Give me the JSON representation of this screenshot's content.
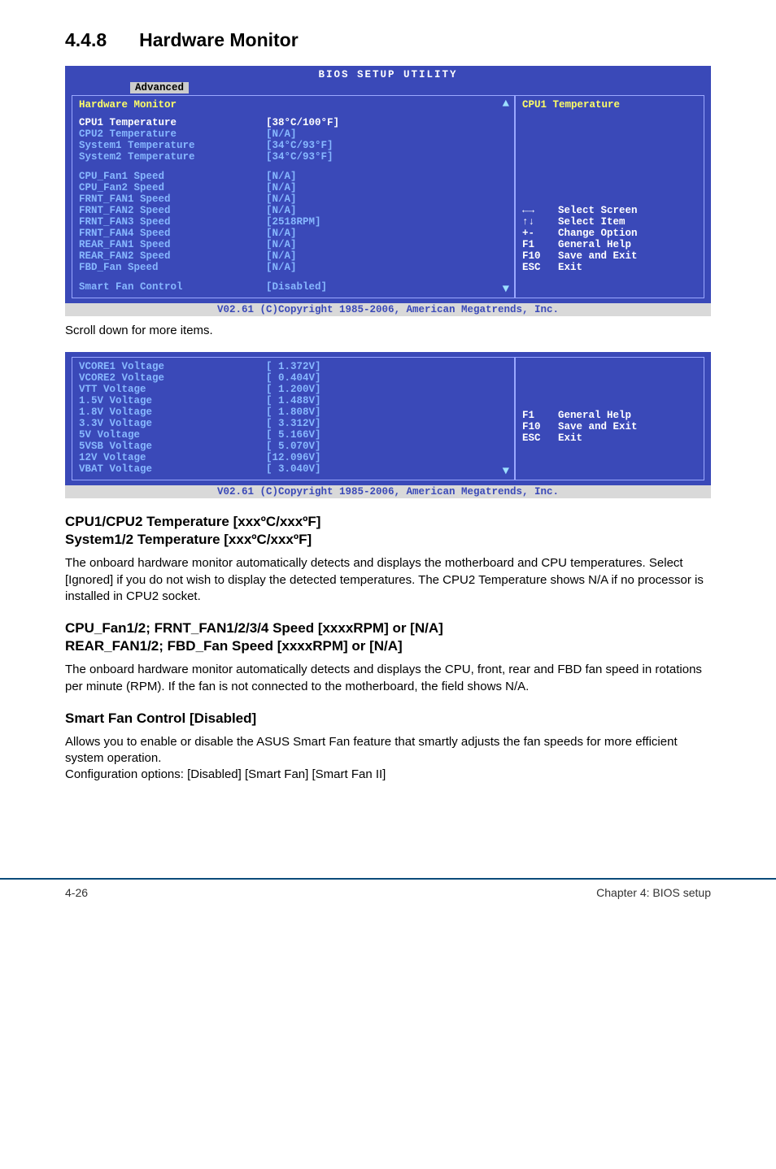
{
  "section": {
    "num": "4.4.8",
    "title": "Hardware Monitor"
  },
  "bios1": {
    "title": "BIOS SETUP UTILITY",
    "tab": "Advanced",
    "heading": "Hardware Monitor",
    "rows_group1": [
      {
        "label": "CPU1 Temperature",
        "value": "[38°C/100°F]"
      },
      {
        "label": "CPU2 Temperature",
        "value": "[N/A]"
      },
      {
        "label": "System1 Temperature",
        "value": "[34°C/93°F]"
      },
      {
        "label": "System2 Temperature",
        "value": "[34°C/93°F]"
      }
    ],
    "rows_group2": [
      {
        "label": "CPU_Fan1 Speed",
        "value": "[N/A]"
      },
      {
        "label": "CPU_Fan2 Speed",
        "value": "[N/A]"
      },
      {
        "label": "FRNT_FAN1 Speed",
        "value": "[N/A]"
      },
      {
        "label": "FRNT_FAN2 Speed",
        "value": "[N/A]"
      },
      {
        "label": "FRNT_FAN3 Speed",
        "value": "[2518RPM]"
      },
      {
        "label": "FRNT_FAN4 Speed",
        "value": "[N/A]"
      },
      {
        "label": "REAR_FAN1 Speed",
        "value": "[N/A]"
      },
      {
        "label": "REAR_FAN2 Speed",
        "value": "[N/A]"
      },
      {
        "label": "FBD_Fan Speed",
        "value": "[N/A]"
      }
    ],
    "smart_fan": {
      "label": "Smart Fan Control",
      "value": "[Disabled]"
    },
    "right_title": "CPU1 Temperature",
    "help": [
      {
        "key": "←→",
        "txt": "Select Screen"
      },
      {
        "key": "↑↓",
        "txt": "Select Item"
      },
      {
        "key": "+-",
        "txt": "Change Option"
      },
      {
        "key": "F1",
        "txt": "General Help"
      },
      {
        "key": "F10",
        "txt": "Save and Exit"
      },
      {
        "key": "ESC",
        "txt": "Exit"
      }
    ],
    "footer": "V02.61 (C)Copyright 1985-2006, American Megatrends, Inc."
  },
  "scroll_note": "Scroll down for more items.",
  "bios2": {
    "rows": [
      {
        "label": "VCORE1 Voltage",
        "value": "[ 1.372V]"
      },
      {
        "label": "VCORE2 Voltage",
        "value": "[ 0.404V]"
      },
      {
        "label": "VTT Voltage",
        "value": "[ 1.200V]"
      },
      {
        "label": "1.5V Voltage",
        "value": "[ 1.488V]"
      },
      {
        "label": "1.8V Voltage",
        "value": "[ 1.808V]"
      },
      {
        "label": "3.3V Voltage",
        "value": "[ 3.312V]"
      },
      {
        "label": "5V Voltage",
        "value": "[ 5.166V]"
      },
      {
        "label": "5VSB Voltage",
        "value": "[ 5.070V]"
      },
      {
        "label": "12V Voltage",
        "value": "[12.096V]"
      },
      {
        "label": "VBAT Voltage",
        "value": "[ 3.040V]"
      }
    ],
    "help": [
      {
        "key": "F1",
        "txt": "General Help"
      },
      {
        "key": "F10",
        "txt": "Save and Exit"
      },
      {
        "key": "ESC",
        "txt": "Exit"
      }
    ],
    "footer": "V02.61 (C)Copyright 1985-2006, American Megatrends, Inc."
  },
  "sub1": {
    "h1": "CPU1/CPU2 Temperature [xxxºC/xxxºF]",
    "h2": "System1/2 Temperature [xxxºC/xxxºF]",
    "body": "The onboard hardware monitor automatically detects and displays the motherboard and CPU temperatures. Select [Ignored] if you do not wish to display the detected temperatures. The CPU2 Temperature shows N/A if no processor is installed in CPU2 socket."
  },
  "sub2": {
    "h1": "CPU_Fan1/2; FRNT_FAN1/2/3/4 Speed [xxxxRPM] or [N/A]",
    "h2": "REAR_FAN1/2; FBD_Fan Speed [xxxxRPM] or [N/A]",
    "body": "The onboard hardware monitor automatically detects and displays the CPU, front, rear and FBD fan speed in rotations per minute (RPM). If the fan is not connected to the motherboard, the field shows N/A."
  },
  "sub3": {
    "h": "Smart Fan Control [Disabled]",
    "body1": "Allows you to enable or disable the ASUS Smart Fan feature that smartly adjusts the fan speeds for more efficient system operation.",
    "body2": "Configuration options: [Disabled] [Smart Fan] [Smart Fan II]"
  },
  "footer": {
    "left": "4-26",
    "right": "Chapter 4: BIOS setup"
  }
}
